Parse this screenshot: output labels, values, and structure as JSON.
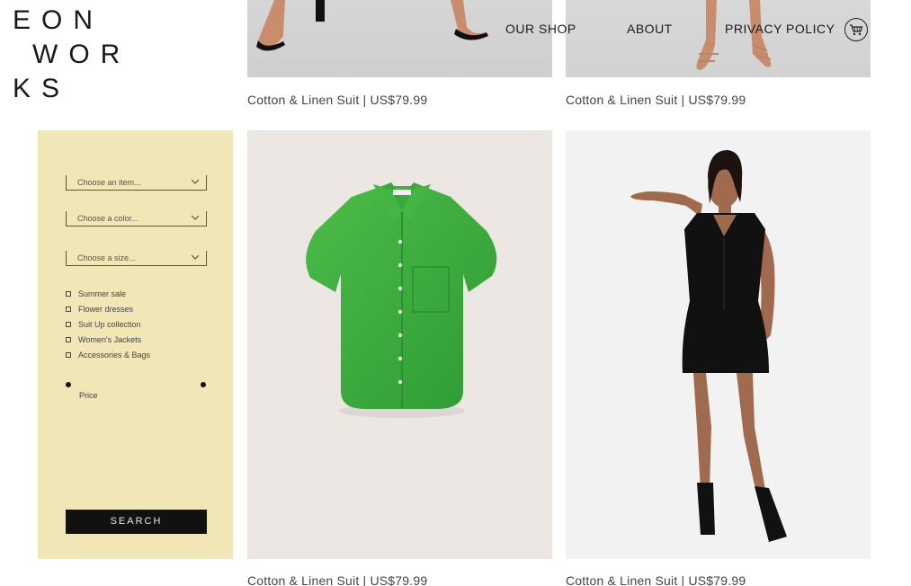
{
  "logo": {
    "line1": "EON",
    "line2": "WOR",
    "line3": "KS"
  },
  "nav": {
    "shop": "OUR SHOP",
    "about": "ABOUT",
    "privacy": "PRIVACY POLICY",
    "cart_icon": "shopping-cart-icon"
  },
  "products": [
    {
      "caption": "Cotton & Linen Suit | US$79.99"
    },
    {
      "caption": "Cotton & Linen Suit | US$79.99"
    },
    {
      "caption": "Cotton & Linen Suit | US$79.99"
    },
    {
      "caption": "Cotton & Linen Suit | US$79.99"
    }
  ],
  "filters": {
    "item_placeholder": "Choose an item...",
    "color_placeholder": "Choose a color...",
    "size_placeholder": "Choose a size...",
    "categories": [
      "Summer sale",
      "Flower dresses",
      "Suit Up collection",
      "Women's Jackets",
      "Accessories & Bags"
    ],
    "price_label": "Price",
    "search_label": "SEARCH"
  },
  "colors": {
    "panel": "#f0e6b6",
    "button": "#111111",
    "shirt": "#3fae3f"
  }
}
